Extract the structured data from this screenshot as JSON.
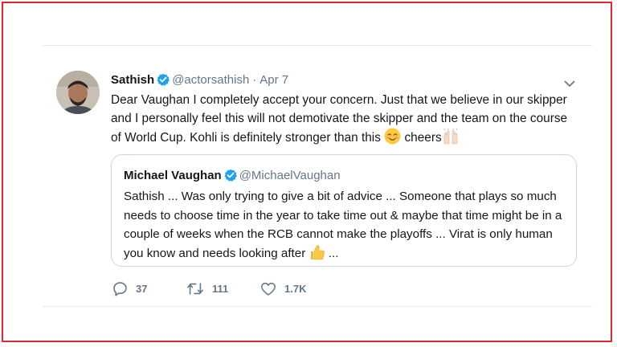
{
  "tweet": {
    "author_name": "Sathish",
    "handle": "@actorsathish",
    "separator": "·",
    "date": "Apr 7",
    "text": "Dear Vaughan I completely accept your concern. Just that we believe in our skipper and I personally feel this will not demotivate the skipper and the team on the course of World Cup. Kohli is definitely stronger than this",
    "text_tail": "cheers",
    "icons": [
      "verified-badge-icon",
      "chevron-down-icon",
      "smiling-face-emoji",
      "raised-hands-emoji"
    ]
  },
  "quoted": {
    "author_name": "Michael Vaughan",
    "handle": "@MichaelVaughan",
    "text": "Sathish ... Was only trying to give a bit of advice ... Someone that plays so much needs to choose time in the year to take time out & maybe that time might be in a couple of weeks when the RCB cannot make the playoffs ... Virat is only human you know and needs looking after",
    "text_tail": "...",
    "icons": [
      "verified-badge-icon",
      "thumbs-up-emoji"
    ]
  },
  "actions": {
    "reply_count": "37",
    "retweet_count": "111",
    "like_count": "1.7K"
  },
  "colors": {
    "frame_border": "#e0282e",
    "verified_blue": "#1da1f2",
    "secondary_text": "#657786",
    "card_border": "#ccd6dd"
  }
}
